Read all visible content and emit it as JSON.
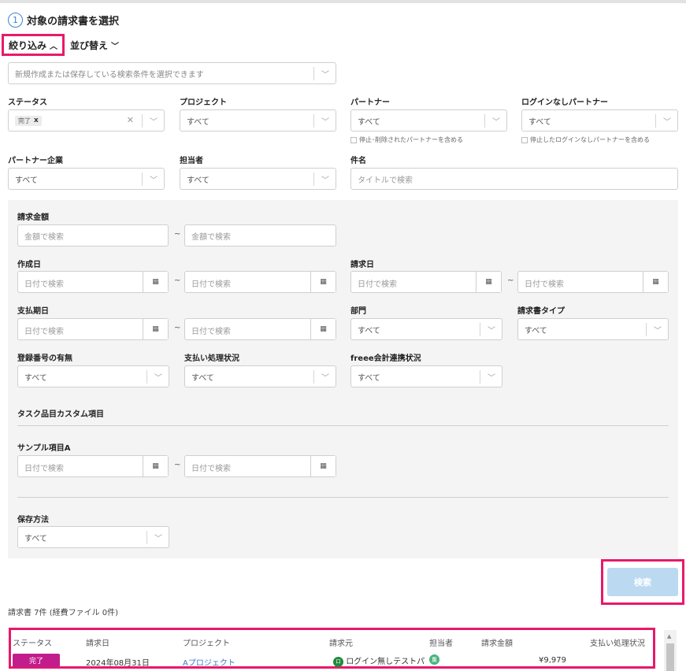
{
  "step": {
    "number": "1",
    "title": "対象の請求書を選択"
  },
  "toggles": {
    "filter": "絞り込み",
    "sort": "並び替え"
  },
  "saved_conditions": {
    "placeholder": "新規作成または保存している検索条件を選択できます"
  },
  "fields": {
    "status": {
      "label": "ステータス",
      "tag": "完了"
    },
    "project": {
      "label": "プロジェクト",
      "value": "すべて"
    },
    "partner": {
      "label": "パートナー",
      "value": "すべて",
      "note": "停止･削除されたパートナーを含める"
    },
    "nologin_partner": {
      "label": "ログインなしパートナー",
      "value": "すべて",
      "note": "停止したログインなしパートナーを含める"
    },
    "partner_company": {
      "label": "パートナー企業",
      "value": "すべて"
    },
    "assignee": {
      "label": "担当者",
      "value": "すべて"
    },
    "subject": {
      "label": "件名",
      "placeholder": "タイトルで検索"
    },
    "amount": {
      "label": "請求金額",
      "placeholder_from": "金額で検索",
      "placeholder_to": "金額で検索"
    },
    "created_date": {
      "label": "作成日",
      "placeholder": "日付で検索"
    },
    "invoice_date": {
      "label": "請求日",
      "placeholder": "日付で検索"
    },
    "due_date": {
      "label": "支払期日",
      "placeholder": "日付で検索"
    },
    "department": {
      "label": "部門",
      "value": "すべて"
    },
    "invoice_type": {
      "label": "請求書タイプ",
      "value": "すべて"
    },
    "registration": {
      "label": "登録番号の有無",
      "value": "すべて"
    },
    "payment_status": {
      "label": "支払い処理状況",
      "value": "すべて"
    },
    "freee_status": {
      "label": "freee会計連携状況",
      "value": "すべて"
    },
    "custom_section": {
      "label": "タスク品目カスタム項目"
    },
    "sample_a": {
      "label": "サンプル項目A",
      "placeholder": "日付で検索"
    },
    "save_method": {
      "label": "保存方法",
      "value": "すべて"
    }
  },
  "tilde": "~",
  "search_button": "検索",
  "result_count": "請求書 7件 (経費ファイル 0件)",
  "table": {
    "headers": [
      "ステータス",
      "請求日",
      "プロジェクト",
      "請求元",
      "担当者",
      "請求金額",
      "支払い処理状況"
    ],
    "row": {
      "status": "完了",
      "date": "2024年08月31日",
      "project": "Aプロジェクト",
      "issuer": "ログイン無しテストパ",
      "issuer_avatar": "ロ",
      "assignee_avatar": "薫",
      "amount": "¥9,979"
    }
  },
  "colors": {
    "accent": "#e8196a",
    "link": "#3a78c7",
    "status_done": "#c21d8c",
    "search_btn": "#bcd9f2"
  }
}
